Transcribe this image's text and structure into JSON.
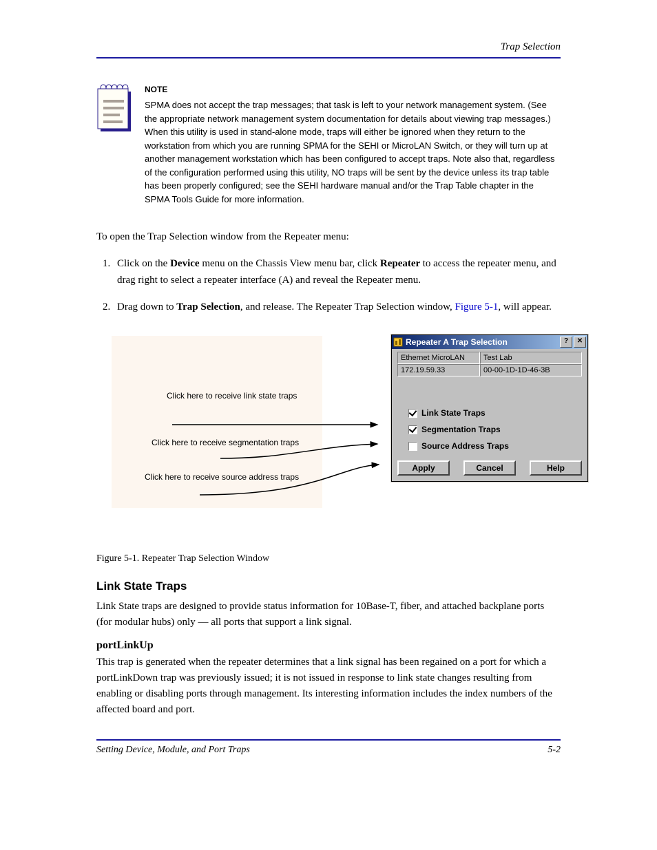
{
  "header_title": "Trap Selection",
  "note": {
    "label": "NOTE",
    "body": "SPMA does not accept the trap messages; that task is left to your network management system. (See the appropriate network management system documentation for details about viewing trap messages.) When this utility is used in stand-alone mode, traps will either be ignored when they return to the workstation from which you are running SPMA for the SEHI or MicroLAN Switch, or they will turn up at another management workstation which has been configured to accept traps. Note also that, regardless of the configuration performed using this utility, NO traps will be sent by the device unless its trap table has been properly configured; see the SEHI hardware manual and/or the Trap Table chapter in the SPMA Tools Guide for more information."
  },
  "intro": "To open the Trap Selection window from the Repeater menu:",
  "steps": [
    {
      "pre": "Click on the ",
      "bold1": "Device",
      "mid1": " menu on the Chassis View menu bar, click ",
      "bold2": "Repeater ",
      "mid2": "to access the repeater menu, and drag right to select a repeater interface (A) and reveal the Repeater menu."
    },
    {
      "pre": "Drag down to ",
      "bold1": "Trap Selection",
      "mid1": ", and release. The Repeater Trap Selection window, ",
      "linkref": "Figure 5-1",
      "mid2": ", will appear."
    }
  ],
  "diagram_labels": {
    "l1": "Click here to receive link state traps",
    "l2": "Click here to receive segmentation traps",
    "l3": "Click here to receive source address traps"
  },
  "dialog": {
    "title": "Repeater A Trap Selection",
    "info": {
      "r1c1": "Ethernet MicroLAN",
      "r1c2": "Test Lab",
      "r2c1": "172.19.59.33",
      "r2c2": "00-00-1D-1D-46-3B"
    },
    "cb1": {
      "label": "Link State Traps",
      "checked": true
    },
    "cb2": {
      "label": "Segmentation Traps",
      "checked": true
    },
    "cb3": {
      "label": "Source Address Traps",
      "checked": false
    },
    "buttons": {
      "apply": "Apply",
      "cancel": "Cancel",
      "help": "Help"
    }
  },
  "figure_caption": "Figure 5-1. Repeater Trap Selection Window",
  "section": {
    "title": "Link State Traps",
    "p1": "Link State traps are designed to provide status information for 10Base-T, fiber, and attached backplane ports (for modular hubs) only — all ports that support a link signal.",
    "sub": "portLinkUp",
    "p2": "This trap is generated when the repeater determines that a link signal has been regained on a port for which a portLinkDown trap was previously issued; it is not issued in response to link state changes resulting from enabling or disabling ports through management. Its interesting information includes the index numbers of the affected board and port."
  },
  "footer": {
    "left": "Setting Device, Module, and Port Traps",
    "right": "5-2"
  }
}
